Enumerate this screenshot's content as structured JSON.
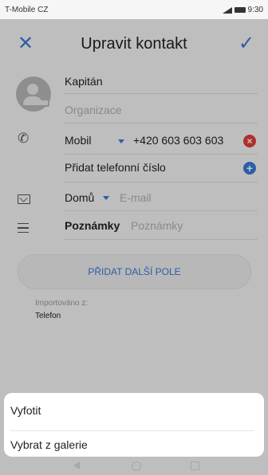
{
  "status_bar": {
    "carrier": "T-Mobile CZ",
    "time": "9:30"
  },
  "header": {
    "title": "Upravit kontakt",
    "close_label": "✕",
    "confirm_label": "✓"
  },
  "form": {
    "name_value": "Kapitán",
    "organization_placeholder": "Organizace",
    "phone_type": "Mobil",
    "phone_value": "+420 603 603 603",
    "add_phone_label": "Přidat telefonní číslo",
    "email_type": "Domů",
    "email_placeholder": "E-mail",
    "notes_label": "Poznámky",
    "notes_placeholder": "Poznámky",
    "more_fields_label": "PŘIDAT DALŠÍ POLE",
    "imported_label": "Importováno z:",
    "imported_value": "Telefon"
  },
  "sheet": {
    "items": [
      "Vyfotit",
      "Vybrat z galerie"
    ]
  },
  "colors": {
    "accent": "#3a78d8",
    "danger": "#e23b3b"
  }
}
